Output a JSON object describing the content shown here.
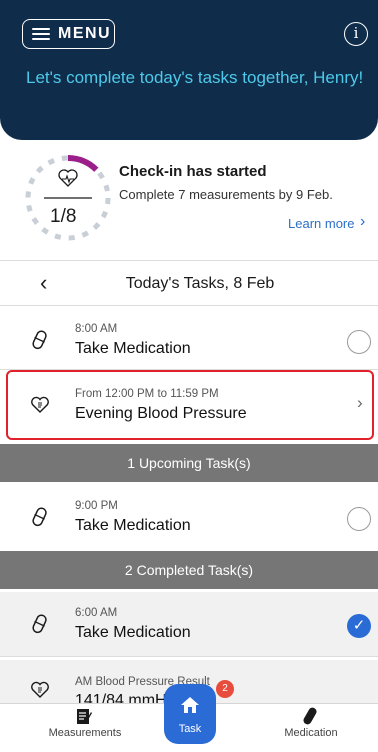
{
  "header": {
    "menu_label": "MENU",
    "info_icon": "info-icon",
    "greeting": "Let's complete today's tasks together, Henry!"
  },
  "checkin": {
    "progress_fraction": "1/8",
    "progress_value": 0.125,
    "title": "Check-in has started",
    "subtitle": "Complete 7 measurements by 9 Feb.",
    "learn_more": "Learn more",
    "colors": {
      "progress": "#9b1f8a",
      "track": "#c9cfd6"
    }
  },
  "date_nav": {
    "title": "Today's Tasks, 8 Feb"
  },
  "tasks": [
    {
      "time": "8:00 AM",
      "label": "Take Medication",
      "icon": "pill-icon",
      "state": "open"
    },
    {
      "time": "From 12:00 PM to 11:59 PM",
      "label": "Evening Blood Pressure",
      "icon": "heart-icon",
      "state": "action"
    }
  ],
  "upcoming_header": "1 Upcoming Task(s)",
  "upcoming": [
    {
      "time": "9:00 PM",
      "label": "Take Medication",
      "icon": "pill-icon",
      "state": "open"
    }
  ],
  "completed_header": "2 Completed Task(s)",
  "completed": [
    {
      "time": "6:00 AM",
      "label": "Take Medication",
      "icon": "pill-icon",
      "state": "done"
    },
    {
      "time": "AM Blood Pressure Result",
      "label": "141/84 mmHg",
      "icon": "heart-icon",
      "state": "done"
    }
  ],
  "bottom_nav": {
    "left_label": "Measurements",
    "center_label": "Task",
    "center_badge": "2",
    "right_label": "Medication"
  },
  "colors": {
    "header_bg": "#0f2d4a",
    "greeting_text": "#4ec9ea",
    "accent": "#2b6bd6",
    "highlight_border": "#e0202a",
    "section_bg": "#767676"
  }
}
